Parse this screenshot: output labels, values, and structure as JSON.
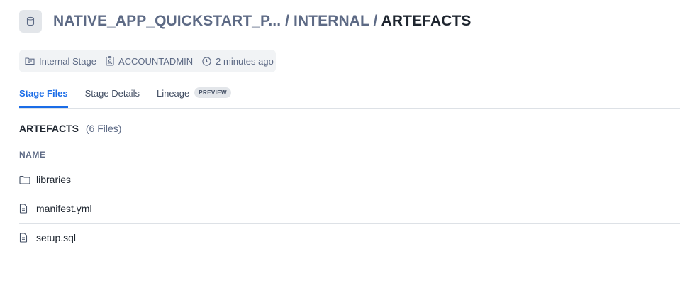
{
  "header": {
    "icon": "database-icon",
    "breadcrumb": {
      "database": "NATIVE_APP_QUICKSTART_P...",
      "schema": "INTERNAL",
      "separator": "/",
      "current": "ARTEFACTS"
    }
  },
  "meta": {
    "type": {
      "icon": "stage-icon",
      "label": "Internal Stage"
    },
    "owner": {
      "icon": "owner-badge-icon",
      "label": "ACCOUNTADMIN"
    },
    "updated": {
      "icon": "clock-icon",
      "label": "2 minutes ago"
    }
  },
  "tabs": [
    {
      "label": "Stage Files",
      "active": true
    },
    {
      "label": "Stage Details",
      "active": false
    },
    {
      "label": "Lineage",
      "active": false,
      "badge": "PREVIEW"
    }
  ],
  "section": {
    "title": "ARTEFACTS",
    "count": "(6 Files)"
  },
  "table": {
    "column_header": "NAME",
    "rows": [
      {
        "icon": "folder-icon",
        "name": "libraries"
      },
      {
        "icon": "file-icon",
        "name": "manifest.yml"
      },
      {
        "icon": "file-icon",
        "name": "setup.sql"
      }
    ]
  },
  "colors": {
    "accent": "#1a6ce7",
    "text": "#1e252f",
    "muted": "#5d6a85",
    "border": "#dde1e6"
  }
}
